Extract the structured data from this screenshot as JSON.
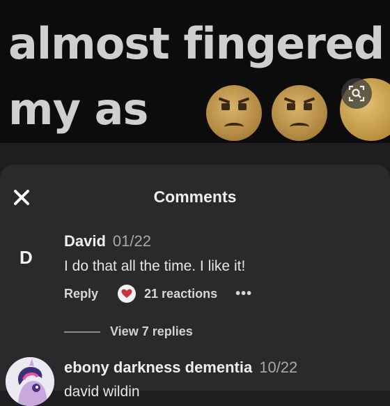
{
  "meme": {
    "line0": "",
    "line1": "almost fingered",
    "line2": "my as"
  },
  "sheet": {
    "title": "Comments"
  },
  "comments": [
    {
      "avatar_letter": "D",
      "author": "David",
      "date": "01/22",
      "text": "I do that all the time. I like it!",
      "reply_label": "Reply",
      "reactions_label": "21 reactions",
      "more_label": "•••",
      "view_replies_label": "View 7 replies"
    },
    {
      "author": "ebony darkness dementia",
      "date": "10/22",
      "text": "david wildin"
    }
  ],
  "colors": {
    "sheet_bg": "#2a2a2c",
    "heart": "#c9343c"
  }
}
